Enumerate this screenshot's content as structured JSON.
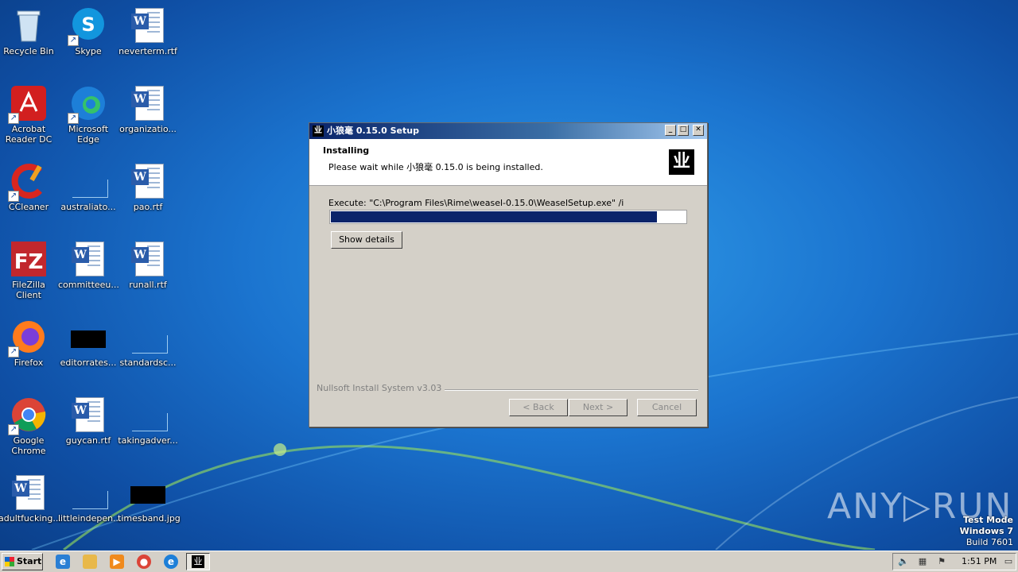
{
  "desktop": {
    "icons": [
      {
        "label": "Recycle Bin",
        "icon": "recycle-bin-icon"
      },
      {
        "label": "Skype",
        "icon": "skype-icon"
      },
      {
        "label": "neverterm.rtf",
        "icon": "word-document-icon"
      },
      {
        "label": "Acrobat Reader DC",
        "icon": "acrobat-icon"
      },
      {
        "label": "Microsoft Edge",
        "icon": "edge-icon"
      },
      {
        "label": "organizatio...",
        "icon": "word-document-icon"
      },
      {
        "label": "CCleaner",
        "icon": "ccleaner-icon"
      },
      {
        "label": "australiato...",
        "icon": "blank-file-icon"
      },
      {
        "label": "pao.rtf",
        "icon": "word-document-icon"
      },
      {
        "label": "FileZilla Client",
        "icon": "filezilla-icon"
      },
      {
        "label": "committeeu...",
        "icon": "word-document-icon"
      },
      {
        "label": "runall.rtf",
        "icon": "word-document-icon"
      },
      {
        "label": "Firefox",
        "icon": "firefox-icon"
      },
      {
        "label": "editorrates...",
        "icon": "black-thumbnail-icon"
      },
      {
        "label": "standardsc...",
        "icon": "blank-file-icon"
      },
      {
        "label": "Google Chrome",
        "icon": "chrome-icon"
      },
      {
        "label": "guycan.rtf",
        "icon": "word-document-icon"
      },
      {
        "label": "takingadver...",
        "icon": "blank-file-icon"
      },
      {
        "label": "adultfucking...",
        "icon": "word-document-icon"
      },
      {
        "label": "littleindepen...",
        "icon": "blank-file-icon"
      },
      {
        "label": "timesband.jpg",
        "icon": "black-thumbnail-icon"
      }
    ]
  },
  "installer": {
    "title": "小狼毫 0.15.0 Setup",
    "logo_glyph": "业",
    "header_title": "Installing",
    "header_subtitle": "Please wait while 小狼毫 0.15.0 is being installed.",
    "execute_text": "Execute: \"C:\\Program Files\\Rime\\weasel-0.15.0\\WeaselSetup.exe\" /i",
    "progress_fraction": 0.92,
    "show_details_label": "Show details",
    "branding": "Nullsoft Install System v3.03",
    "back_label": "< Back",
    "next_label": "Next >",
    "cancel_label": "Cancel",
    "minimize_glyph": "_",
    "maximize_glyph": "□",
    "close_glyph": "✕"
  },
  "watermark": {
    "brand": "ANY▷RUN",
    "mode": "Test Mode",
    "os": "Windows 7",
    "build": "Build 7601"
  },
  "taskbar": {
    "start_label": "Start",
    "clock": "1:51 PM",
    "quicklaunch": [
      "ie-icon",
      "explorer-icon",
      "media-player-icon",
      "chrome-icon",
      "edge-icon"
    ]
  },
  "colors": {
    "titlebar_start": "#0a246a",
    "progress_fill": "#0a246a",
    "dialog_face": "#d4d0c8"
  }
}
